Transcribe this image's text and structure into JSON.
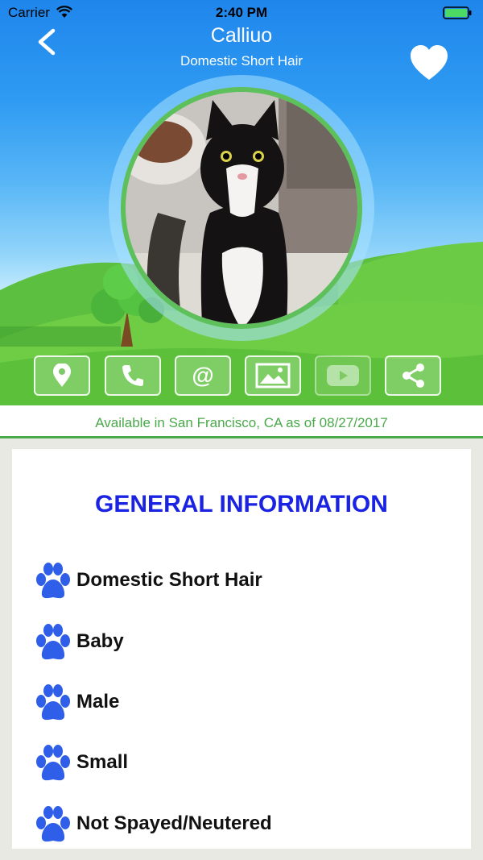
{
  "status_bar": {
    "carrier": "Carrier",
    "time": "2:40 PM"
  },
  "header": {
    "title": "Calliuo",
    "subtitle": "Domestic Short Hair"
  },
  "icons": {
    "back": "chevron-left-icon",
    "favorite": "heart-icon",
    "actions": [
      "location-pin-icon",
      "phone-icon",
      "at-email-icon",
      "image-gallery-icon",
      "video-play-icon",
      "share-icon"
    ]
  },
  "availability": "Available  in San Francisco, CA as of 08/27/2017",
  "general": {
    "title": "GENERAL INFORMATION",
    "items": [
      "Domestic Short Hair",
      "Baby",
      "Male",
      "Small",
      "Not Spayed/Neutered"
    ]
  },
  "colors": {
    "accent_green": "#4aa94a",
    "title_blue": "#1a23e2",
    "paw_blue": "#2f5ee8"
  }
}
